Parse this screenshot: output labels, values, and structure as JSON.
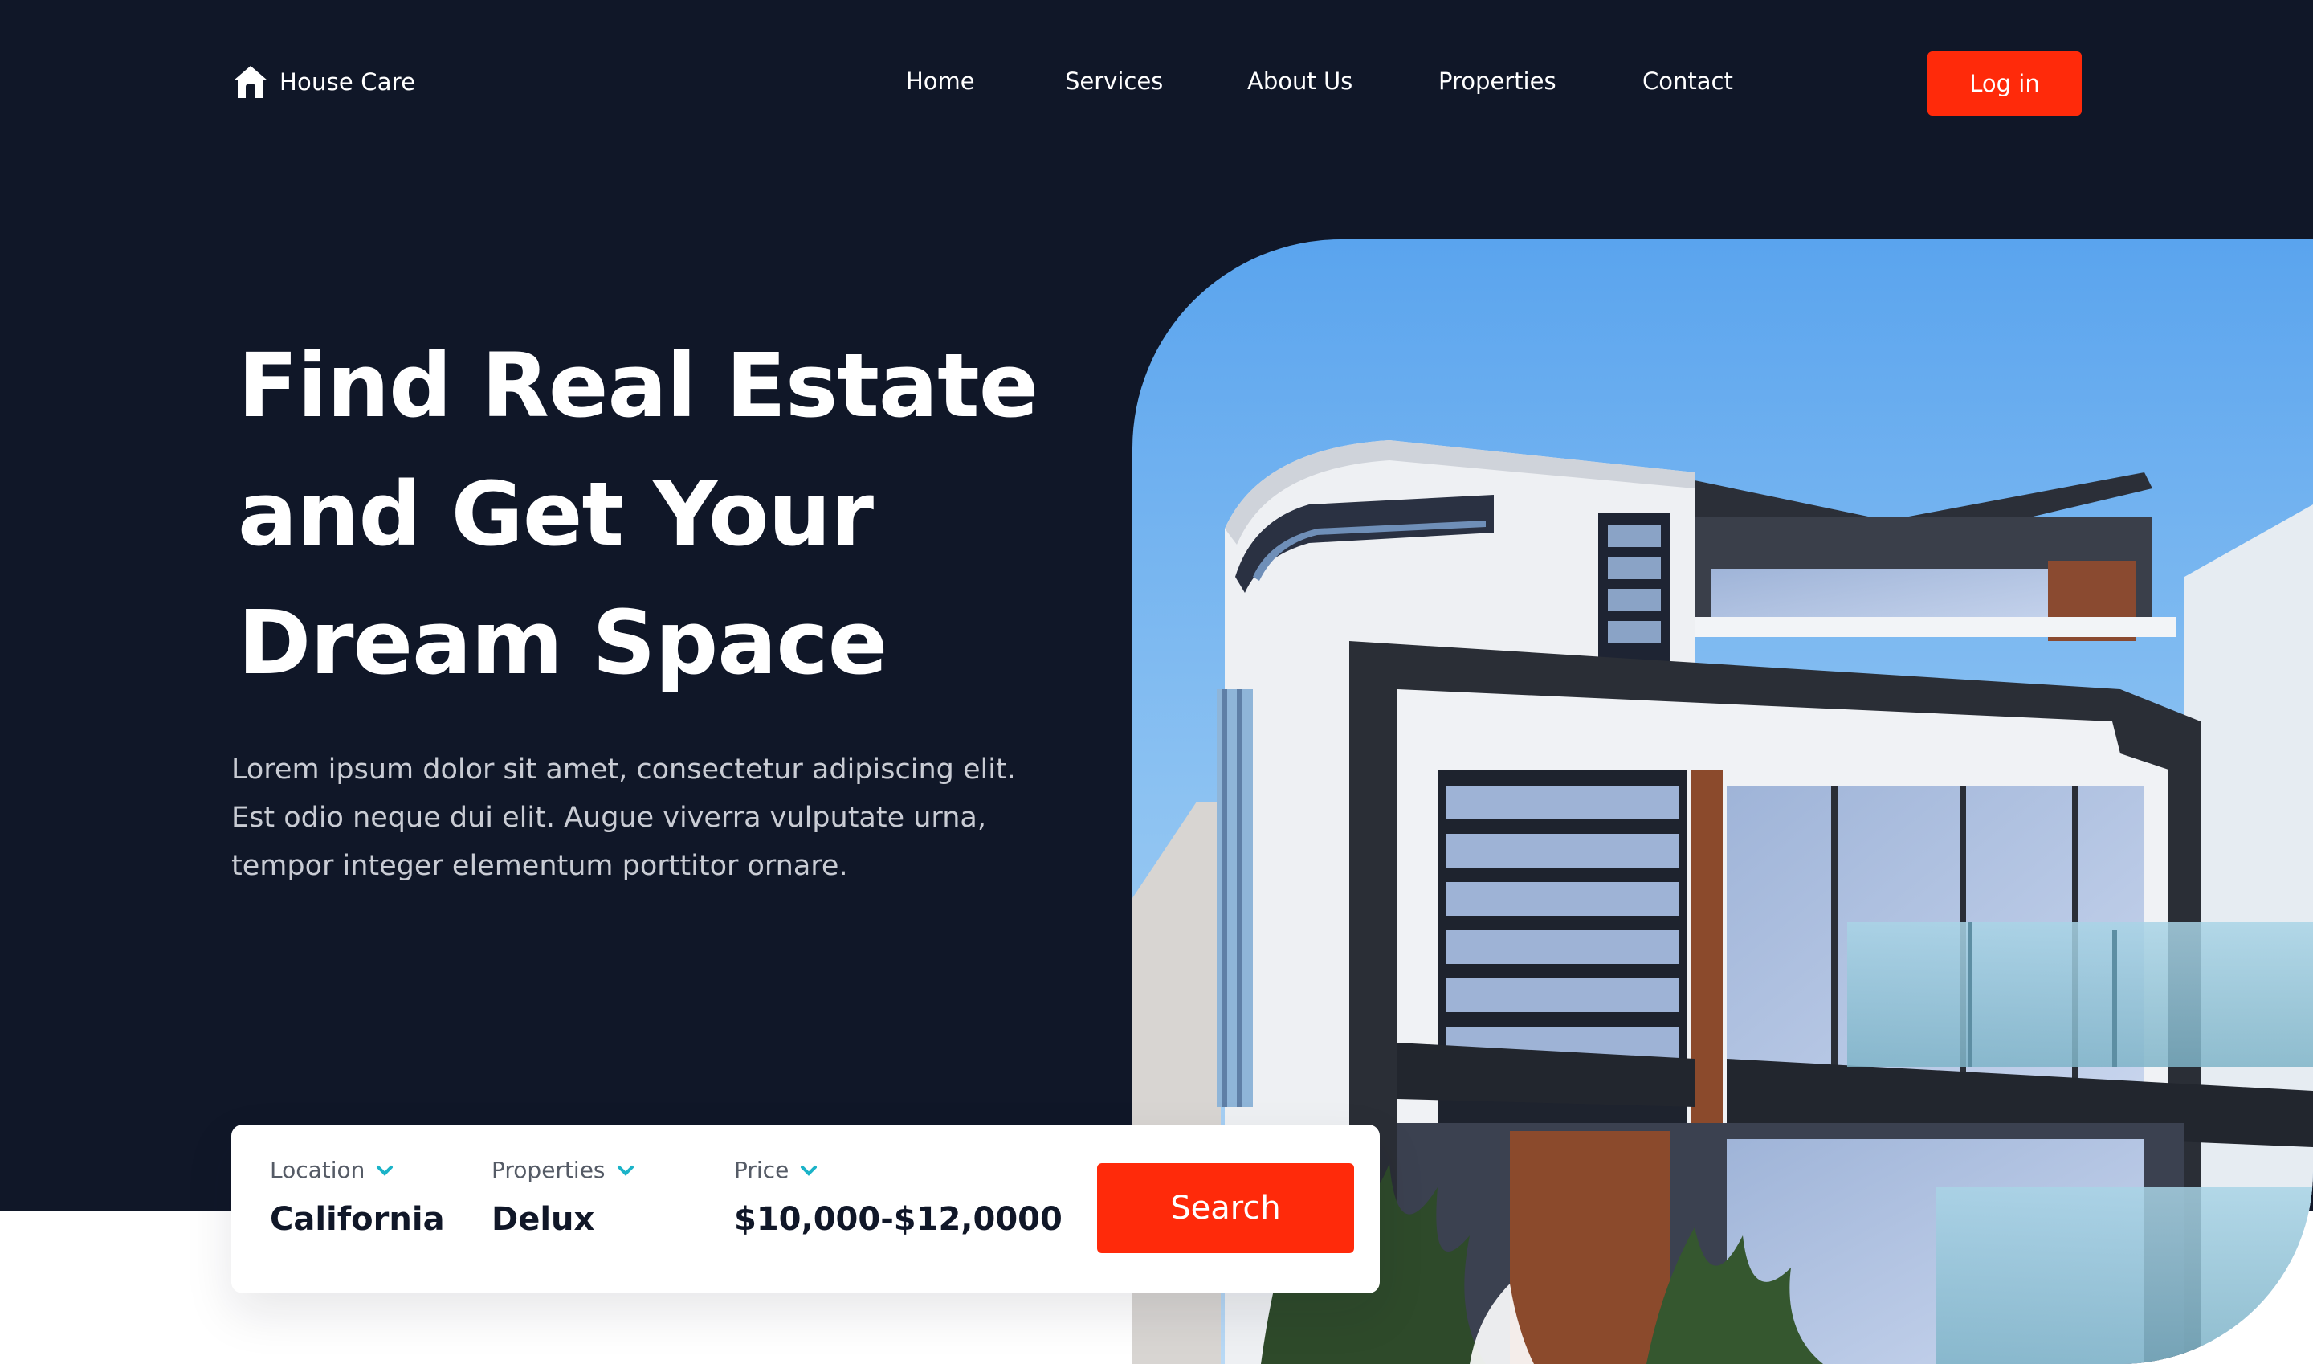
{
  "brand": {
    "name": "House Care",
    "icon": "home-icon"
  },
  "nav": {
    "links": [
      "Home",
      "Services",
      "About Us",
      "Properties",
      "Contact"
    ],
    "login_label": "Log in"
  },
  "hero": {
    "headline_lines": [
      "Find Real Estate",
      "and Get Your",
      "Dream Space"
    ],
    "description_lines": [
      "Lorem ipsum dolor sit amet, consectetur adipiscing elit.",
      "Est odio neque dui elit. Augue viverra vulputate urna,",
      "tempor integer elementum porttitor ornare."
    ]
  },
  "search": {
    "location": {
      "label": "Location",
      "value": "California"
    },
    "properties": {
      "label": "Properties",
      "value": "Delux"
    },
    "price": {
      "label": "Price",
      "value": "$10,000-$12,0000"
    },
    "button_label": "Search"
  },
  "colors": {
    "background_dark": "#101728",
    "accent": "#ff2a0a",
    "chevron": "#1bb3c8",
    "text_light": "#ffffff",
    "text_muted": "#c9ccd4"
  }
}
